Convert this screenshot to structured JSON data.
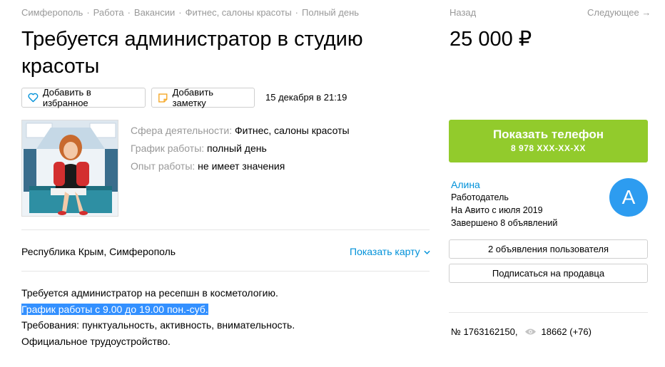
{
  "breadcrumb": [
    "Симферополь",
    "Работа",
    "Вакансии",
    "Фитнес, салоны красоты",
    "Полный день"
  ],
  "title": "Требуется администратор в студию красоты",
  "actions": {
    "favorite_label": "Добавить в избранное",
    "note_label": "Добавить заметку",
    "date": "15 декабря в 21:19"
  },
  "params": [
    {
      "key": "Сфера деятельности:",
      "value": "Фитнес, салоны красоты"
    },
    {
      "key": "График работы:",
      "value": "полный день"
    },
    {
      "key": "Опыт работы:",
      "value": "не имеет значения"
    }
  ],
  "location": {
    "address": "Республика Крым, Симферополь",
    "map_link": "Показать карту"
  },
  "description": [
    "Требуется администратор на ресепшн в косметологию.",
    "График работы с 9.00 до 19.00 пон.-суб.",
    "Требования: пунктуальность, активность, внимательность.",
    "Официальное трудоустройство."
  ],
  "nav": {
    "back": "Назад",
    "next": "Следующее →"
  },
  "price": "25 000 ₽",
  "phone": {
    "label": "Показать телефон",
    "number": "8 978 XXX-XX-XX"
  },
  "seller": {
    "name": "Алина",
    "type": "Работодатель",
    "since": "На Авито с июля 2019",
    "completed": "Завершено 8 объявлений",
    "avatar_letter": "А",
    "ads_button": "2 объявления пользователя",
    "subscribe_button": "Подписаться на продавца"
  },
  "meta": {
    "id": "№ 1763162150,",
    "views": "18662 (+76)"
  },
  "colors": {
    "accent": "#0091d9",
    "phone_button": "#92cb2c",
    "avatar": "#2d9cf0",
    "highlight": "#3390ff"
  }
}
